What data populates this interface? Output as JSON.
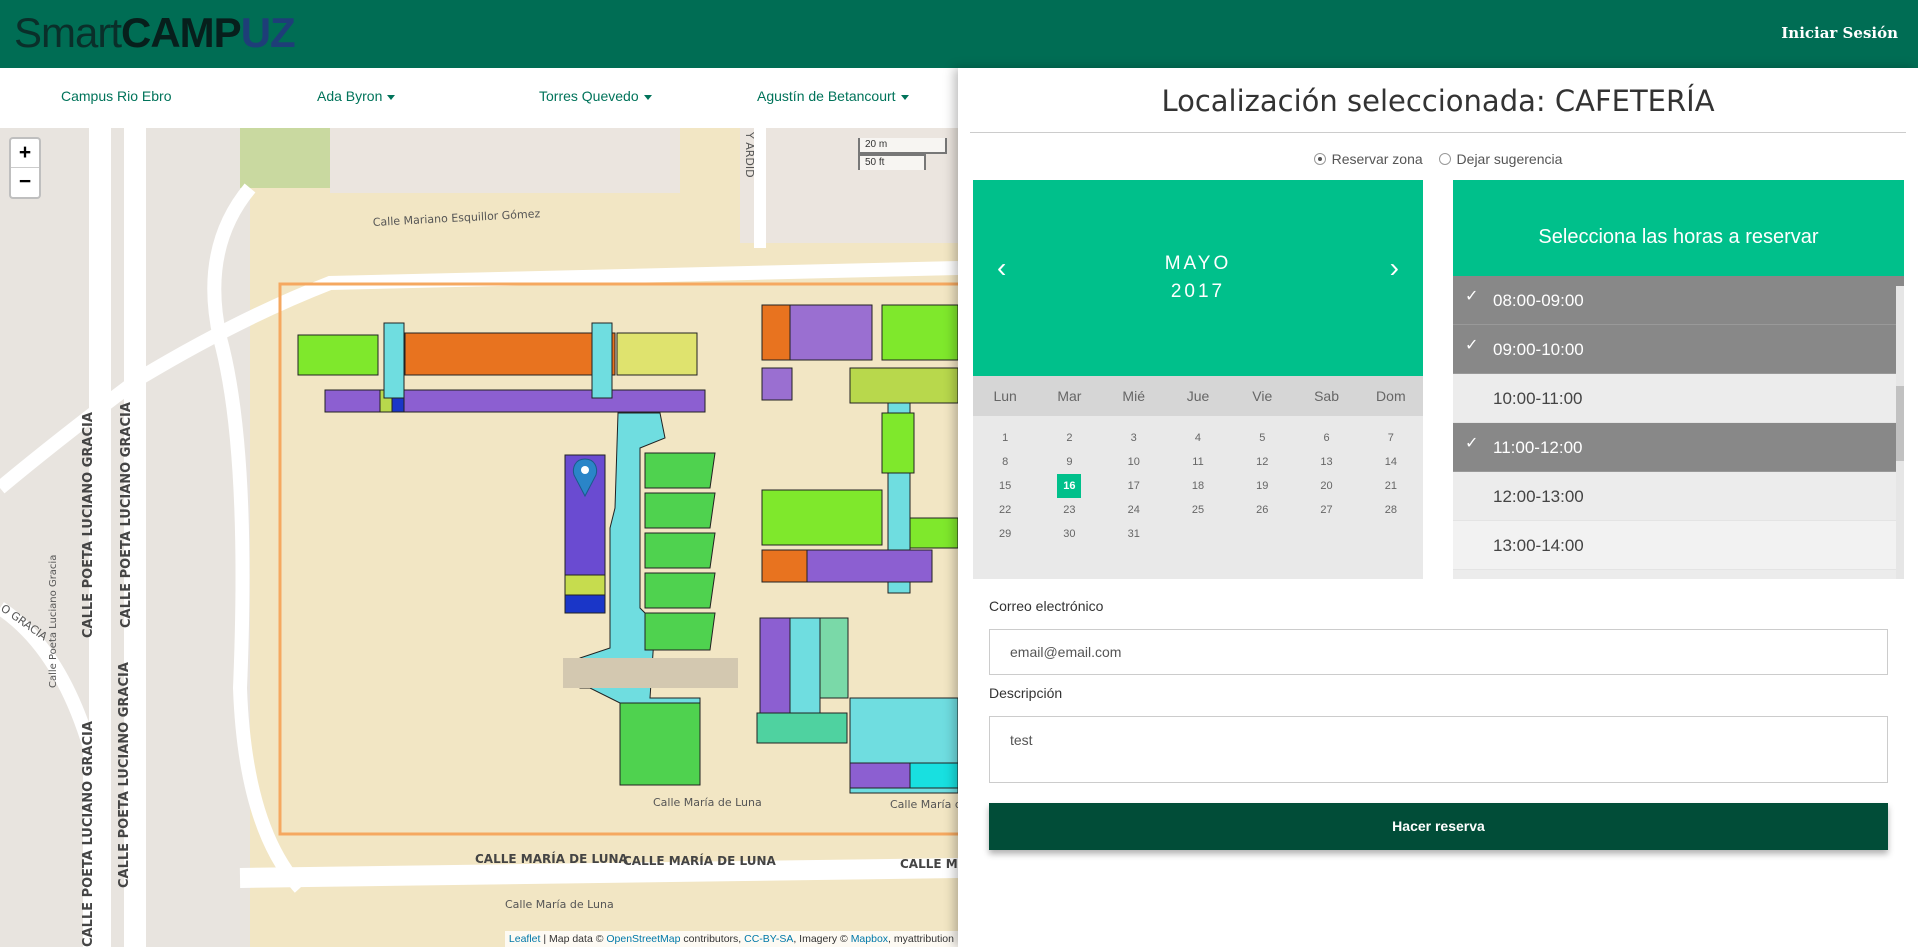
{
  "app": {
    "logo_smart": "Smart",
    "logo_camp": "CAMP",
    "logo_uz": "UZ",
    "login_label": "Iniciar Sesión"
  },
  "nav": {
    "items": [
      {
        "label": "Campus Rio Ebro",
        "dropdown": false
      },
      {
        "label": "Ada Byron",
        "dropdown": true
      },
      {
        "label": "Torres Quevedo",
        "dropdown": true
      },
      {
        "label": "Agustín de Betancourt",
        "dropdown": true
      }
    ]
  },
  "map": {
    "zoom_in": "+",
    "zoom_out": "−",
    "scale_m": "20 m",
    "scale_ft": "50 ft",
    "streets": {
      "mariano": "Calle Mariano Esquillor Gómez",
      "poeta1": "CALLE POETA LUCIANO GRACIA",
      "poeta2": "CALLE POETA LUCIANO GRACIA",
      "poeta3": "Calle Poeta Luciano Gracia",
      "maria_luna_small": "Calle María de Luna",
      "maria_luna_small2": "Calle María de Luna",
      "maria_luna_big1": "CALLE MARÍA DE LUNA",
      "maria_luna_big2": "CALLE MARÍA DE LUNA",
      "maria_luna_big3": "CALLE MARÍ",
      "maria_luna_bottom": "Calle María de Luna",
      "ardid": "Y ARDID",
      "gracia_diag": "O GRACIA"
    },
    "attribution": {
      "leaflet": "Leaflet",
      "text1": " | Map data © ",
      "osm": "OpenStreetMap",
      "text2": " contributors, ",
      "license": "CC-BY-SA",
      "text3": ", Imagery © ",
      "mapbox": "Mapbox",
      "text4": ", myattribution"
    }
  },
  "panel": {
    "title": "Localización seleccionada: CAFETERÍA",
    "radio_reserve": "Reservar zona",
    "radio_suggest": "Dejar sugerencia",
    "calendar": {
      "month": "MAYO",
      "year": "2017",
      "prev": "‹",
      "next": "›",
      "weekdays": [
        "Lun",
        "Mar",
        "Mié",
        "Jue",
        "Vie",
        "Sab",
        "Dom"
      ],
      "weeks": [
        [
          "1",
          "2",
          "3",
          "4",
          "5",
          "6",
          "7"
        ],
        [
          "8",
          "9",
          "10",
          "11",
          "12",
          "13",
          "14"
        ],
        [
          "15",
          "16",
          "17",
          "18",
          "19",
          "20",
          "21"
        ],
        [
          "22",
          "23",
          "24",
          "25",
          "26",
          "27",
          "28"
        ],
        [
          "29",
          "30",
          "31",
          "",
          "",
          "",
          ""
        ]
      ],
      "selected_day": "16"
    },
    "hours": {
      "header": "Selecciona las horas a reservar",
      "items": [
        {
          "label": "08:00-09:00",
          "selected": true
        },
        {
          "label": "09:00-10:00",
          "selected": true
        },
        {
          "label": "10:00-11:00",
          "selected": false
        },
        {
          "label": "11:00-12:00",
          "selected": true
        },
        {
          "label": "12:00-13:00",
          "selected": false
        },
        {
          "label": "13:00-14:00",
          "selected": false
        }
      ],
      "check": "✓"
    },
    "email_label": "Correo electrónico",
    "email_placeholder": "email@email.com",
    "description_label": "Descripción",
    "description_value": "test",
    "submit_label": "Hacer reserva"
  },
  "colors": {
    "topbar": "#006d54",
    "accent": "#00c08b",
    "button": "#014d38"
  }
}
